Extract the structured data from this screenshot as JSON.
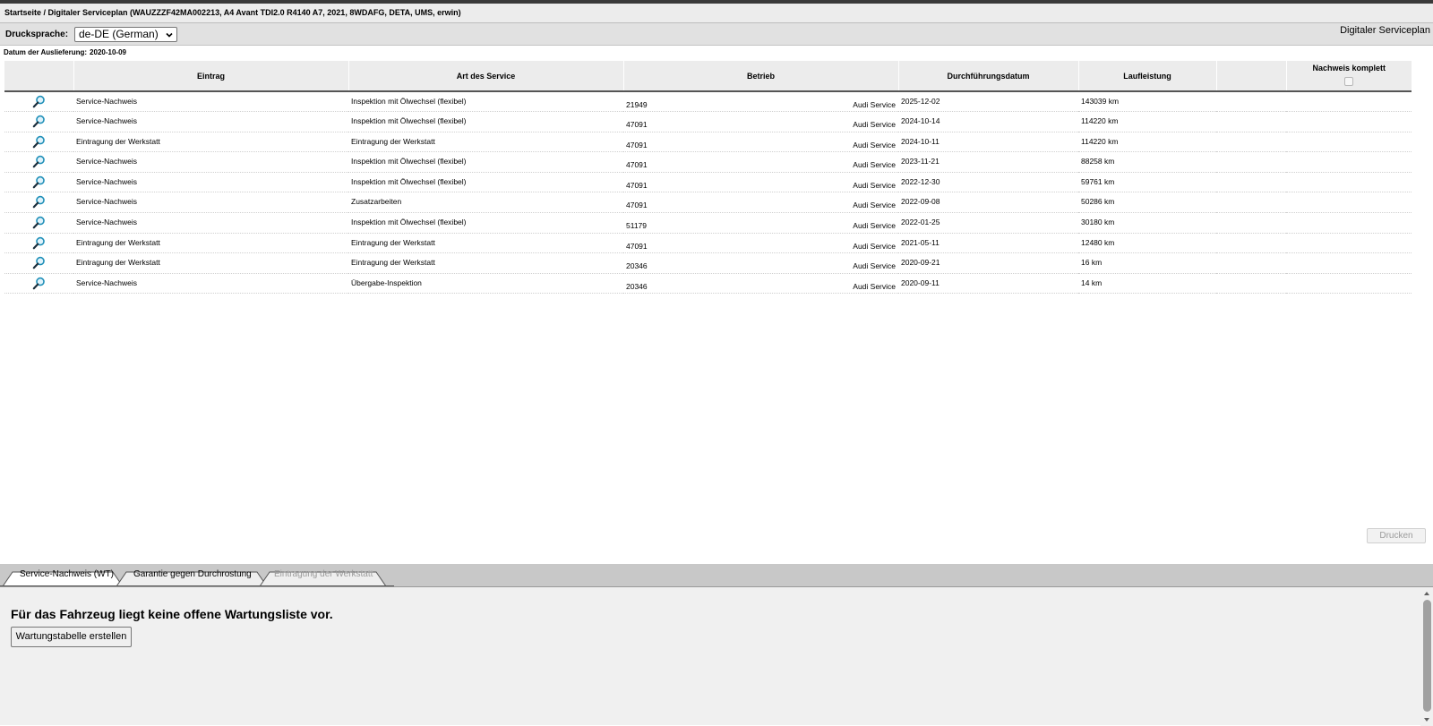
{
  "breadcrumb": "Startseite / Digitaler Serviceplan (WAUZZZF42MA002213, A4 Avant TDI2.0 R4140 A7, 2021, 8WDAFG, DETA, UMS, erwin)",
  "toolbar": {
    "print_language_label": "Drucksprache:",
    "print_language_value": "de-DE (German)",
    "module_title": "Digitaler Serviceplan"
  },
  "delivery": {
    "label": "Datum der Auslieferung:",
    "value": "2020-10-09"
  },
  "table": {
    "headers": {
      "entry": "Eintrag",
      "service_type": "Art des Service",
      "workshop": "Betrieb",
      "date": "Durchführungsdatum",
      "mileage": "Laufleistung",
      "extra": "",
      "proof_complete": "Nachweis komplett"
    },
    "rows": [
      {
        "entry": "Service-Nachweis",
        "service_type": "Inspektion mit Ölwechsel (flexibel)",
        "workshop_code": "21949",
        "workshop_name": "Audi Service",
        "date": "2025-12-02",
        "mileage": "143039 km"
      },
      {
        "entry": "Service-Nachweis",
        "service_type": "Inspektion mit Ölwechsel (flexibel)",
        "workshop_code": "47091",
        "workshop_name": "Audi Service",
        "date": "2024-10-14",
        "mileage": "114220 km"
      },
      {
        "entry": "Eintragung der Werkstatt",
        "service_type": "Eintragung der Werkstatt",
        "workshop_code": "47091",
        "workshop_name": "Audi Service",
        "date": "2024-10-11",
        "mileage": "114220 km"
      },
      {
        "entry": "Service-Nachweis",
        "service_type": "Inspektion mit Ölwechsel (flexibel)",
        "workshop_code": "47091",
        "workshop_name": "Audi Service",
        "date": "2023-11-21",
        "mileage": "88258 km"
      },
      {
        "entry": "Service-Nachweis",
        "service_type": "Inspektion mit Ölwechsel (flexibel)",
        "workshop_code": "47091",
        "workshop_name": "Audi Service",
        "date": "2022-12-30",
        "mileage": "59761 km"
      },
      {
        "entry": "Service-Nachweis",
        "service_type": "Zusatzarbeiten",
        "workshop_code": "47091",
        "workshop_name": "Audi Service",
        "date": "2022-09-08",
        "mileage": "50286 km"
      },
      {
        "entry": "Service-Nachweis",
        "service_type": "Inspektion mit Ölwechsel (flexibel)",
        "workshop_code": "51179",
        "workshop_name": "Audi Service",
        "date": "2022-01-25",
        "mileage": "30180 km"
      },
      {
        "entry": "Eintragung der Werkstatt",
        "service_type": "Eintragung der Werkstatt",
        "workshop_code": "47091",
        "workshop_name": "Audi Service",
        "date": "2021-05-11",
        "mileage": "12480 km"
      },
      {
        "entry": "Eintragung der Werkstatt",
        "service_type": "Eintragung der Werkstatt",
        "workshop_code": "20346",
        "workshop_name": "Audi Service",
        "date": "2020-09-21",
        "mileage": "16 km"
      },
      {
        "entry": "Service-Nachweis",
        "service_type": "Übergabe-Inspektion",
        "workshop_code": "20346",
        "workshop_name": "Audi Service",
        "date": "2020-09-11",
        "mileage": "14 km"
      }
    ]
  },
  "print_button": "Drucken",
  "tabs": [
    {
      "label": "Service-Nachweis (WT)",
      "state": "active"
    },
    {
      "label": "Garantie gegen Durchrostung",
      "state": "normal"
    },
    {
      "label": "Eintragung der Werkstatt",
      "state": "disabled"
    }
  ],
  "panel": {
    "message": "Für das Fahrzeug liegt keine offene Wartungsliste vor.",
    "create_button": "Wartungstabelle erstellen"
  },
  "icons": {
    "row_detail": "magnifier-icon",
    "select_arrow": "chevron-down-icon"
  },
  "colors": {
    "header_bg": "#ececec",
    "tabbar_bg": "#c8c8c8",
    "magnifier": "#1f8fb8"
  }
}
